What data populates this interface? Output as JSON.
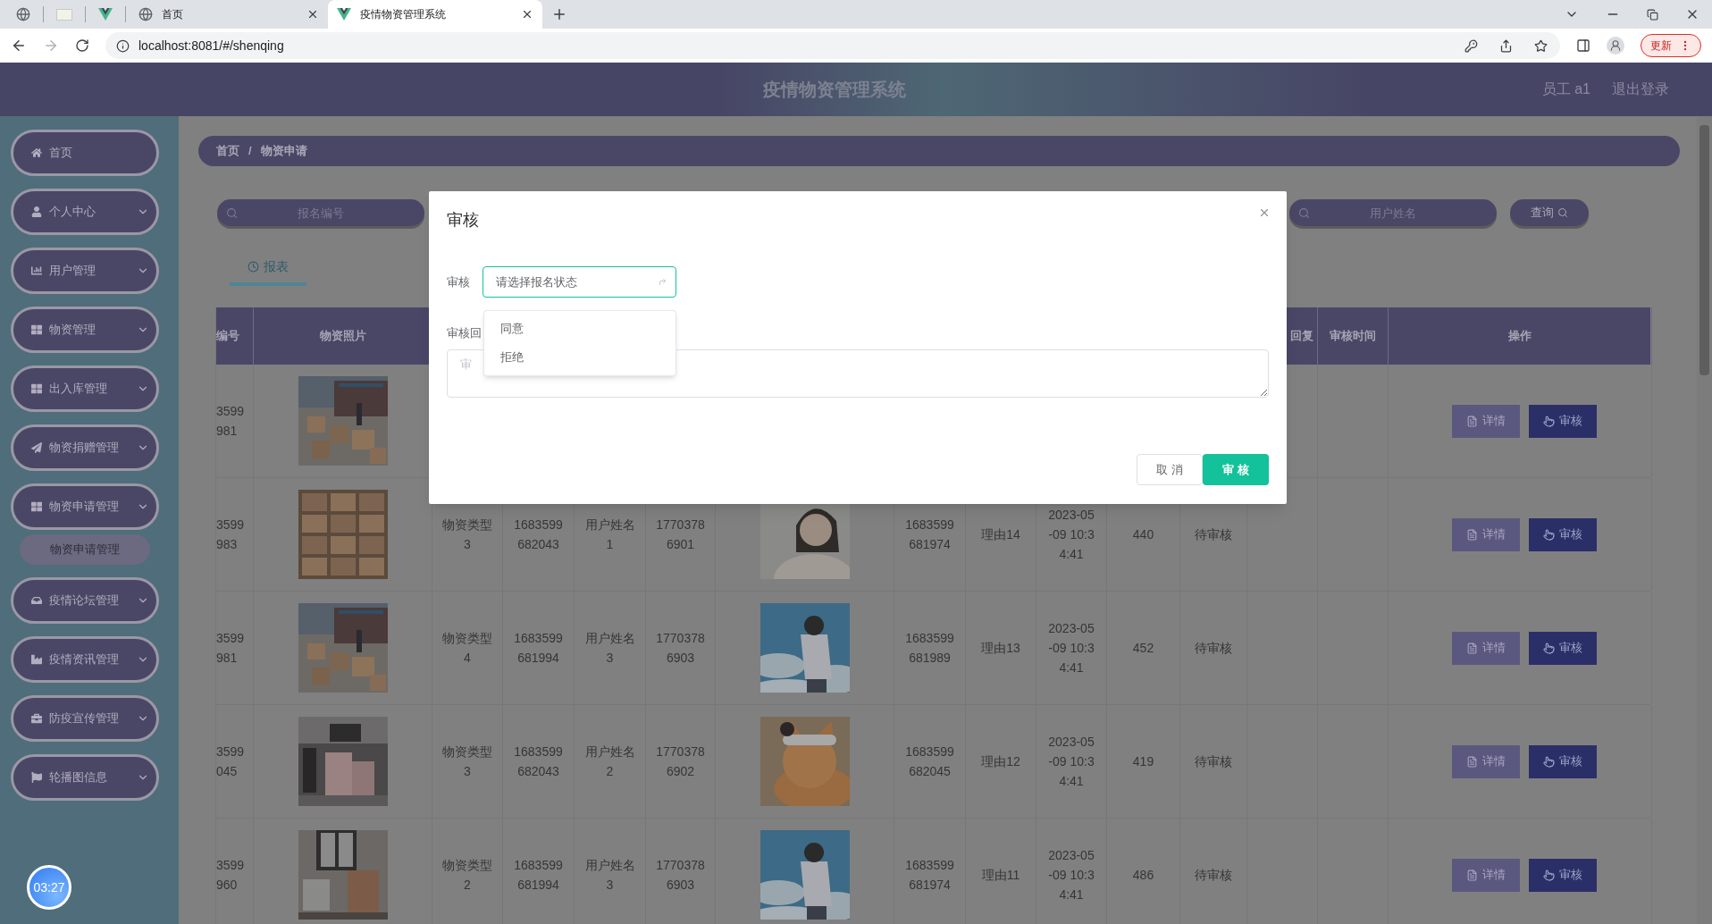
{
  "browser": {
    "tabs": [
      {
        "label": "首页",
        "selected": false
      },
      {
        "label": "疫情物资管理系统",
        "selected": true
      }
    ],
    "address": "localhost:8081/#/shenqing",
    "update_button": "更新"
  },
  "header": {
    "title": "疫情物资管理系统",
    "user": "员工 a1",
    "logout": "退出登录"
  },
  "sidebar": {
    "items": [
      {
        "label": "首页",
        "kind": "link"
      },
      {
        "label": "个人中心",
        "kind": "menu"
      },
      {
        "label": "用户管理",
        "kind": "menu"
      },
      {
        "label": "物资管理",
        "kind": "menu"
      },
      {
        "label": "出入库管理",
        "kind": "menu"
      },
      {
        "label": "物资捐赠管理",
        "kind": "menu"
      },
      {
        "label": "物资申请管理",
        "kind": "menu",
        "children": [
          {
            "label": "物资申请管理"
          }
        ]
      },
      {
        "label": "疫情论坛管理",
        "kind": "menu"
      },
      {
        "label": "疫情资讯管理",
        "kind": "menu"
      },
      {
        "label": "防疫宣传管理",
        "kind": "menu"
      },
      {
        "label": "轮播图信息",
        "kind": "menu"
      }
    ]
  },
  "clock": "03:27",
  "breadcrumb": {
    "items": [
      "首页",
      "物资申请"
    ],
    "separator": "/"
  },
  "search": {
    "fields": [
      {
        "placeholder": "报名编号"
      },
      {
        "placeholder": "用户姓名"
      }
    ],
    "button": "查询"
  },
  "tabs": [
    {
      "label": "报表",
      "selected": true
    }
  ],
  "table": {
    "columns": [
      "编号",
      "物资照片",
      "回复",
      "审核时间",
      "操作"
    ],
    "rows": [
      {
        "number": "3599 981",
        "actions": [
          "详情",
          "审核"
        ]
      },
      {
        "number": "3599 983",
        "column_2": "物资类型3",
        "column_3": "1683599682043",
        "column_4": "用户姓名1",
        "column_5": "17703786901",
        "column_7": "1683599681974",
        "column_8": "理由14",
        "column_9": "2023-05-09 10:34:41",
        "column_10": "440",
        "column_11": "待审核",
        "actions": [
          "详情",
          "审核"
        ]
      },
      {
        "number": "3599 981",
        "column_2": "物资类型4",
        "column_3": "1683599681994",
        "column_4": "用户姓名3",
        "column_5": "17703786903",
        "column_7": "1683599681989",
        "column_8": "理由13",
        "column_9": "2023-05-09 10:34:41",
        "column_10": "452",
        "column_11": "待审核",
        "actions": [
          "详情",
          "审核"
        ]
      },
      {
        "number": "3599 045",
        "column_2": "物资类型3",
        "column_3": "1683599682043",
        "column_4": "用户姓名2",
        "column_5": "17703786902",
        "column_7": "1683599682045",
        "column_8": "理由12",
        "column_9": "2023-05-09 10:34:41",
        "column_10": "419",
        "column_11": "待审核",
        "actions": [
          "详情",
          "审核"
        ]
      },
      {
        "number": "3599 960",
        "column_2": "物资类型2",
        "column_3": "1683599681994",
        "column_4": "用户姓名3",
        "column_5": "17703786903",
        "column_7": "1683599681974",
        "column_8": "理由11",
        "column_9": "2023-05-09 10:34:41",
        "column_10": "486",
        "column_11": "待审核",
        "actions": [
          "详情",
          "审核"
        ]
      }
    ]
  },
  "dialog": {
    "title": "审核",
    "select": {
      "label": "审核",
      "placeholder": "请选择报名状态",
      "open": true,
      "options": [
        {
          "label": "同意"
        },
        {
          "label": "拒绝"
        }
      ]
    },
    "reply": {
      "label": "审核回",
      "placeholder": "审"
    },
    "buttons": [
      {
        "label": "取消",
        "kind": "secondary"
      },
      {
        "label": "审核",
        "kind": "primary"
      }
    ]
  }
}
